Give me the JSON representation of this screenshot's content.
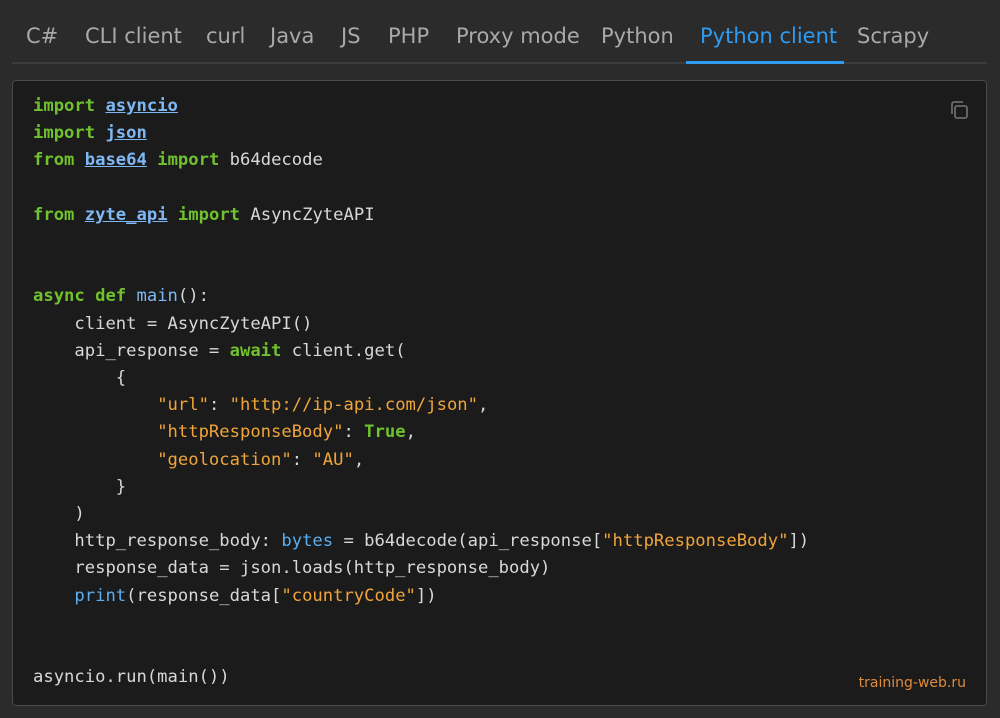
{
  "tabs": [
    {
      "label": "C#"
    },
    {
      "label": "CLI client"
    },
    {
      "label": "curl"
    },
    {
      "label": "Java"
    },
    {
      "label": "JS"
    },
    {
      "label": "PHP"
    },
    {
      "label": "Proxy mode"
    },
    {
      "label": "Python"
    },
    {
      "label": "Python client",
      "active": true
    },
    {
      "label": "Scrapy"
    }
  ],
  "code": {
    "import": "import",
    "from": "from",
    "asyncio": "asyncio",
    "json": "json",
    "base64": "base64",
    "b64decode": "b64decode",
    "zyte_api": "zyte_api",
    "AsyncZyteAPI": "AsyncZyteAPI",
    "async": "async",
    "def": "def",
    "main": "main",
    "line_client": "client = AsyncZyteAPI()",
    "api_response_assign": "api_response = ",
    "await": "await",
    "client_get": " client.get(",
    "brace_open": "{",
    "url_key": "\"url\"",
    "url_value": "\"http://ip-api.com/json\"",
    "body_key": "\"httpResponseBody\"",
    "true_kw": "True",
    "geo_key": "\"geolocation\"",
    "geo_value": "\"AU\"",
    "brace_close": "}",
    "paren_close": ")",
    "http_body_assign": "http_response_body: ",
    "bytes": "bytes",
    "b64_call": " = b64decode(api_response[",
    "body_key_str": "\"httpResponseBody\"",
    "call_close": "])",
    "line_loads": "response_data = json.loads(http_response_body)",
    "print": "print",
    "print_args_open": "(response_data[",
    "country_code": "\"countryCode\"",
    "print_close": "])",
    "run_line": "asyncio.run(main())"
  },
  "watermark": "training-web.ru",
  "copy_icon": "copy-icon"
}
